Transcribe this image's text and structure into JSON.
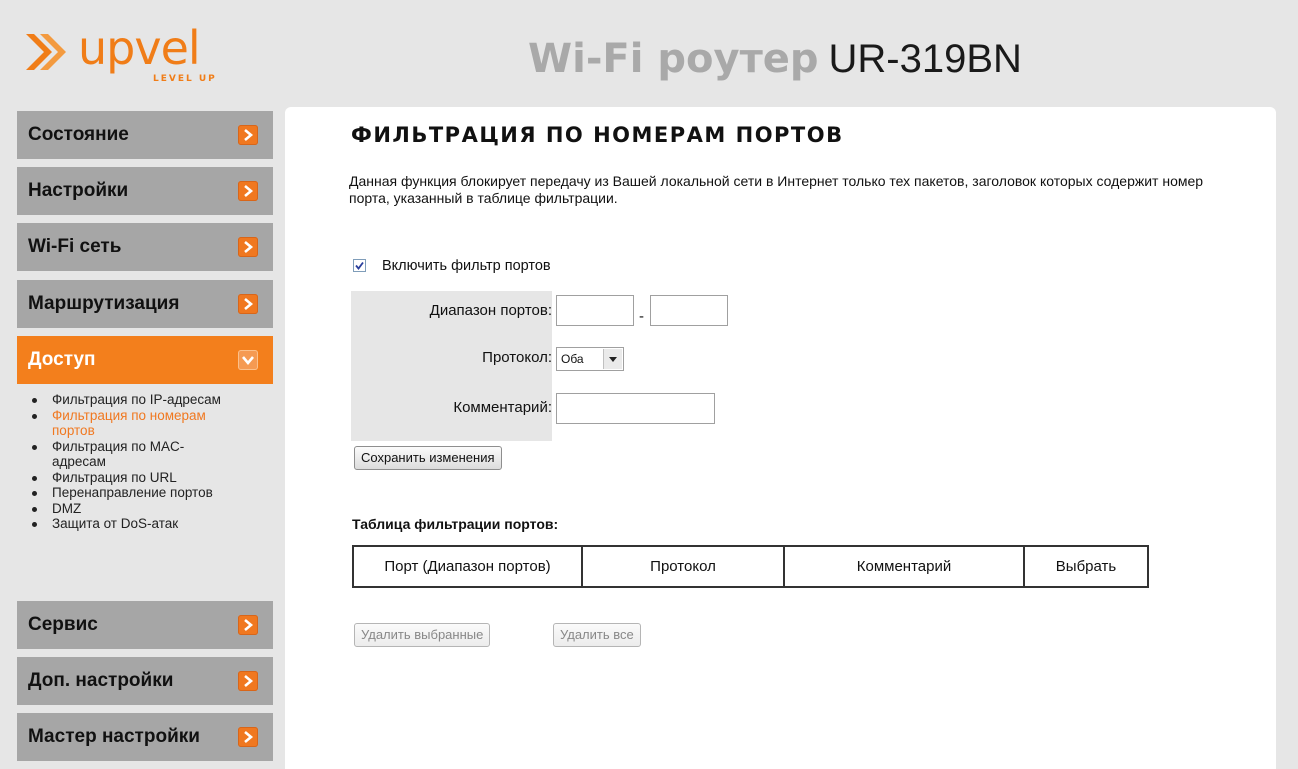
{
  "header": {
    "logo_text": "upvel",
    "logo_tagline": "LEVEL UP",
    "title_brand": "Wi-Fi роутер",
    "title_model": "UR-319BN"
  },
  "sidebar": {
    "items": [
      {
        "label": "Состояние"
      },
      {
        "label": "Настройки"
      },
      {
        "label": "Wi-Fi сеть"
      },
      {
        "label": "Маршрутизация"
      },
      {
        "label": "Доступ"
      },
      {
        "label": "Сервис"
      },
      {
        "label": "Доп. настройки"
      },
      {
        "label": "Мастер настройки"
      }
    ],
    "subitems": [
      {
        "label": "Фильтрация по IP-адресам"
      },
      {
        "label": "Фильтрация по номерам портов"
      },
      {
        "label": "Фильтрация по MAC-адресам"
      },
      {
        "label": "Фильтрация по URL"
      },
      {
        "label": "Перенаправление портов"
      },
      {
        "label": "DMZ"
      },
      {
        "label": "Защита от DoS-атак"
      }
    ]
  },
  "main": {
    "title": "ФИЛЬТРАЦИЯ ПО НОМЕРАМ ПОРТОВ",
    "description": "Данная функция блокирует передачу из Вашей локальной сети в Интернет только тех пакетов, заголовок которых содержит номер порта, указанный в таблице фильтрации.",
    "enable_label": "Включить фильтр портов",
    "enable_checked": true,
    "form": {
      "port_range_label": "Диапазон портов:",
      "port_from": "",
      "port_separator": "-",
      "port_to": "",
      "protocol_label": "Протокол:",
      "protocol_value": "Оба",
      "comment_label": "Комментарий:",
      "comment_value": ""
    },
    "save_button": "Сохранить изменения",
    "table": {
      "caption": "Таблица фильтрации портов:",
      "headers": [
        "Порт (Диапазон портов)",
        "Протокол",
        "Комментарий",
        "Выбрать"
      ],
      "rows": []
    },
    "delete_selected_button": "Удалить выбранные",
    "delete_all_button": "Удалить все"
  }
}
